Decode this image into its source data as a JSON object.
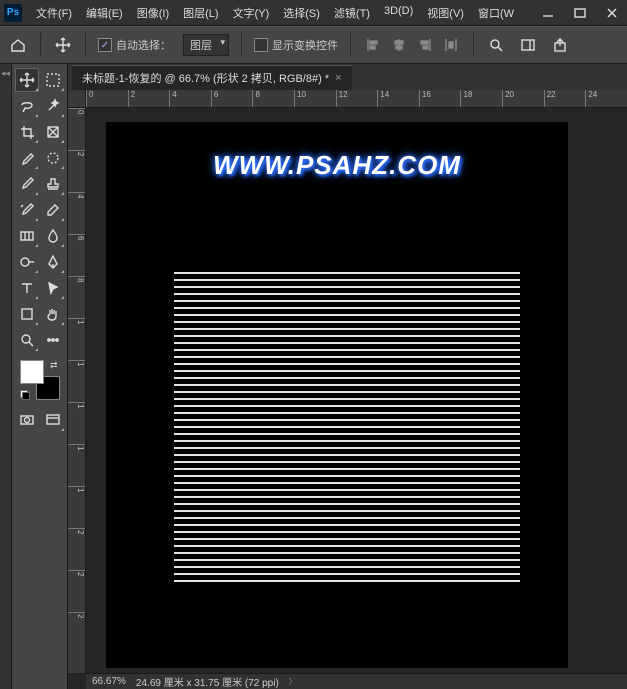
{
  "menu": [
    "文件(F)",
    "编辑(E)",
    "图像(I)",
    "图层(L)",
    "文字(Y)",
    "选择(S)",
    "滤镜(T)",
    "3D(D)",
    "视图(V)",
    "窗口(W"
  ],
  "options": {
    "auto_select": "自动选择：",
    "dd_layer": "图层",
    "show_transform": "显示变换控件"
  },
  "doc": {
    "tab_title": "未标题-1-恢复的 @ 66.7% (形状 2 拷贝, RGB/8#) *"
  },
  "ruler_h": [
    "0",
    "2",
    "4",
    "6",
    "8",
    "10",
    "12",
    "14",
    "16",
    "18",
    "20",
    "22",
    "24"
  ],
  "ruler_v": [
    "0",
    "2",
    "4",
    "6",
    "8",
    "1",
    "1",
    "1",
    "1",
    "1",
    "2",
    "2",
    "2"
  ],
  "canvas": {
    "watermark": "WWW.PSAHZ.COM"
  },
  "status": {
    "zoom": "66.67%",
    "dims": "24.69 厘米 x 31.75 厘米 (72 ppi)"
  }
}
